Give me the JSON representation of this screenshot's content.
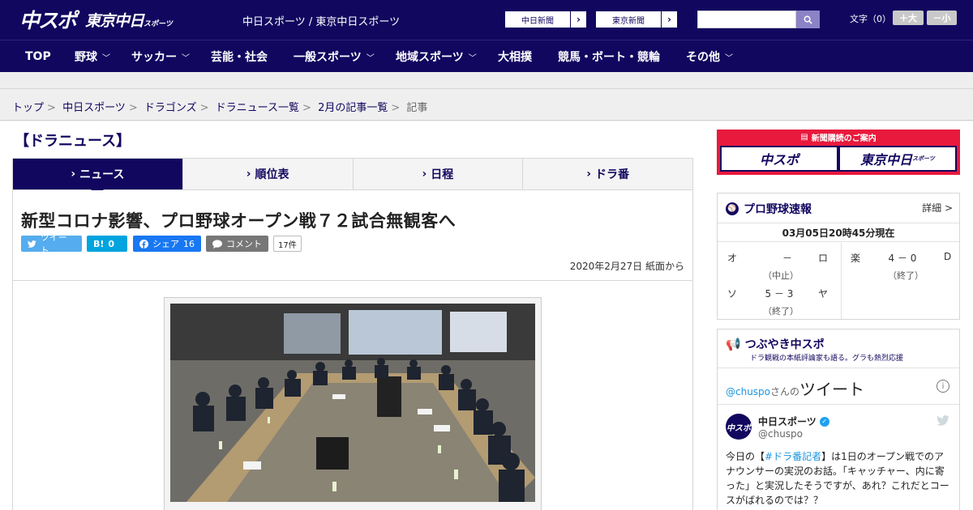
{
  "header": {
    "logo_main": "中スポ",
    "logo_sub": "東京中日",
    "logo_sub_small": "スポーツ",
    "site_name": "中日スポーツ / 東京中日スポーツ",
    "links": [
      {
        "label": "中日新聞"
      },
      {
        "label": "東京新聞"
      }
    ],
    "search": {
      "placeholder": ""
    },
    "font_size_label": "文字（0）",
    "font_plus": "＋大",
    "font_minus": "－小"
  },
  "nav": [
    {
      "label": "TOP",
      "dropdown": false
    },
    {
      "label": "野球",
      "dropdown": true
    },
    {
      "label": "サッカー",
      "dropdown": true
    },
    {
      "label": "芸能・社会",
      "dropdown": false
    },
    {
      "label": "一般スポーツ",
      "dropdown": true
    },
    {
      "label": "地域スポーツ",
      "dropdown": true
    },
    {
      "label": "大相撲",
      "dropdown": false
    },
    {
      "label": "競馬・ボート・競輪",
      "dropdown": false
    },
    {
      "label": "その他",
      "dropdown": true
    }
  ],
  "breadcrumb": [
    "トップ",
    "中日スポーツ",
    "ドラゴンズ",
    "ドラニュース一覧",
    "2月の記事一覧",
    "記事"
  ],
  "section_title": "【ドラニュース】",
  "tabs": [
    {
      "label": "ニュース",
      "active": true
    },
    {
      "label": "順位表",
      "active": false
    },
    {
      "label": "日程",
      "active": false
    },
    {
      "label": "ドラ番",
      "active": false
    }
  ],
  "article": {
    "headline": "新型コロナ影響、プロ野球オープン戦７２試合無観客へ",
    "share": {
      "tweet": "ツイート",
      "hatena_label": "B!",
      "hatena_count": "0",
      "facebook": "シェア",
      "facebook_count": "16",
      "comment": "コメント",
      "comment_count": "17件"
    },
    "date": "2020年2月27日 紙面から"
  },
  "sidebar": {
    "subscribe": {
      "heading": "新聞購読のご案内",
      "logo1": "中スポ",
      "logo2": "東京中日",
      "logo2_small": "スポーツ"
    },
    "scores": {
      "title": "プロ野球速報",
      "detail": "詳細 >",
      "time": "03月05日20時45分現在",
      "games": [
        {
          "home": "オ",
          "score": "－",
          "away": "ロ",
          "status": "（中止）"
        },
        {
          "home": "ソ",
          "score": "5 － 3",
          "away": "ヤ",
          "status": "（終了）"
        },
        {
          "home": "楽",
          "score": "4 － 0",
          "away": "D",
          "status": "（終了）"
        }
      ]
    },
    "tweets": {
      "title": "つぶやき中スポ",
      "subtitle": "ドラ観戦の本紙評論家も語る。グラも熱烈応援",
      "widget_user": "@chuspo",
      "widget_san": "さんの",
      "widget_title": "ツイート",
      "info": "i",
      "avatar_text": "中スポ",
      "name": "中日スポーツ",
      "handle": "@chuspo",
      "text_before": "今日の【",
      "hashtag": "#ドラ番記者",
      "text_after": "】は1日のオープン戦でのアナウンサーの実況のお話。「キャッチャー、内に寄った」と実況したそうですが、あれ？これだとコースがばれるのでは？？"
    }
  }
}
